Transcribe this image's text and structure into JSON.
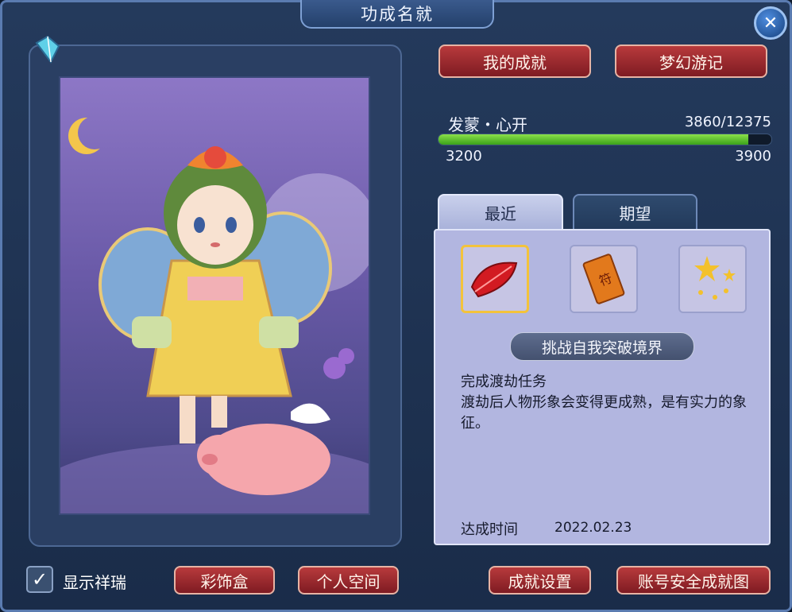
{
  "window": {
    "title": "功成名就",
    "close_icon": "close-icon"
  },
  "top_buttons": {
    "my_achievements": "我的成就",
    "dream_journey": "梦幻游记"
  },
  "progress": {
    "name": "发蒙・心开",
    "value_text": "3860/12375",
    "min": "3200",
    "max": "3900",
    "fill_fraction": 0.93
  },
  "tabs": {
    "recent": "最近",
    "expected": "期望"
  },
  "achievement": {
    "items": [
      {
        "icon": "red-feather-icon",
        "selected": true
      },
      {
        "icon": "talisman-scroll-icon",
        "selected": false
      },
      {
        "icon": "stars-icon",
        "selected": false
      }
    ],
    "title": "挑战自我突破境界",
    "desc_line1": "完成渡劫任务",
    "desc_line2": "渡劫后人物形象会变得更成熟，是有实力的象征。",
    "time_label": "达成时间",
    "time_value": "2022.02.23"
  },
  "bottom": {
    "show_auspicious": "显示祥瑞",
    "show_auspicious_checked": true,
    "decoration_box": "彩饰盒",
    "personal_space": "个人空间",
    "achievement_settings": "成就设置",
    "account_security_map": "账号安全成就图"
  },
  "colors": {
    "accent_red": "#b83a3c",
    "progress_green": "#6cc93a",
    "panel_bg": "#b2b6e0"
  }
}
